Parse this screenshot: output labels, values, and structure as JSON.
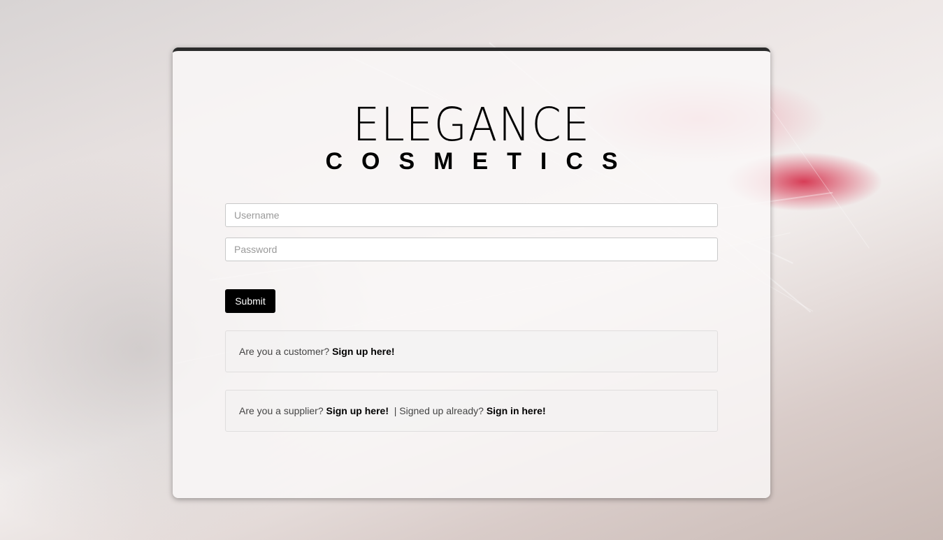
{
  "logo": {
    "line1": "ELEGANCE",
    "line2": "COSMETICS"
  },
  "form": {
    "username_placeholder": "Username",
    "password_placeholder": "Password",
    "submit_label": "Submit"
  },
  "customer_panel": {
    "prompt": "Are you a customer? ",
    "link": "Sign up here!"
  },
  "supplier_panel": {
    "prompt": "Are you a supplier? ",
    "signup_link": "Sign up here!",
    "separator": "  | Signed up already? ",
    "signin_link": "Sign in here!"
  },
  "colors": {
    "accent": "#000000",
    "card_border": "#2b2b2b",
    "lip": "#d21e3c"
  }
}
